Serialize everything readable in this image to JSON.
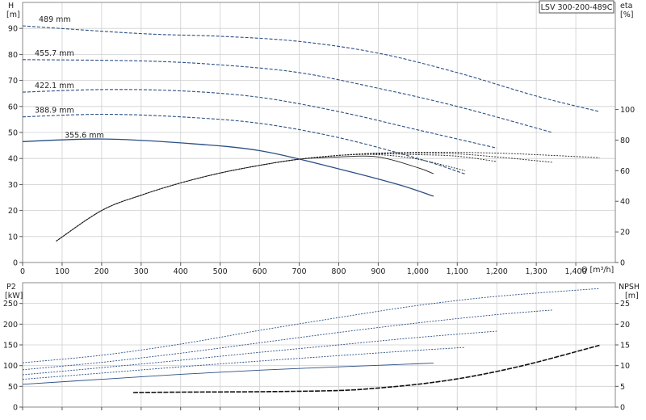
{
  "model_label": "LSV 300-200-489C",
  "colors": {
    "curve": "#2a4f85",
    "eff": "#222222",
    "npsh": "#111111",
    "grid": "#cfcfcf",
    "frame": "#8a8a8a"
  },
  "chart_data": [
    {
      "type": "line",
      "name": "head-efficiency",
      "ylabel": [
        "H",
        "[m]"
      ],
      "y2label": [
        "eta",
        "[%]"
      ],
      "xlabel": "Q [m³/h]",
      "xlim": [
        0,
        1500
      ],
      "ylim": [
        0,
        100
      ],
      "y2lim": [
        0,
        170
      ],
      "xticks": [
        0,
        100,
        200,
        300,
        400,
        500,
        600,
        700,
        800,
        900,
        1000,
        1100,
        1200,
        1300,
        1400
      ],
      "xtick_labels": [
        "0",
        "100",
        "200",
        "300",
        "400",
        "500",
        "600",
        "700",
        "800",
        "900",
        "1,000",
        "1,100",
        "1,200",
        "1,300",
        "1,400"
      ],
      "yticks": [
        0,
        10,
        20,
        30,
        40,
        50,
        60,
        70,
        80,
        90
      ],
      "y2ticks": [
        0,
        20,
        40,
        60,
        80,
        100
      ],
      "grid": true,
      "head_series": [
        {
          "name": "489 mm",
          "x": [
            0,
            300,
            500,
            700,
            900,
            1100,
            1300,
            1460
          ],
          "y": [
            91,
            88,
            87,
            85,
            80.5,
            73,
            64,
            58
          ]
        },
        {
          "name": "455.7 mm",
          "x": [
            0,
            300,
            500,
            700,
            900,
            1100,
            1340
          ],
          "y": [
            78,
            77.5,
            76,
            73,
            67,
            60,
            50
          ]
        },
        {
          "name": "422.1 mm",
          "x": [
            0,
            200,
            400,
            600,
            800,
            1000,
            1200
          ],
          "y": [
            65.5,
            66.5,
            66,
            63.5,
            58,
            51,
            44
          ]
        },
        {
          "name": "388.9 mm",
          "x": [
            0,
            200,
            400,
            600,
            800,
            1000,
            1120
          ],
          "y": [
            56,
            57,
            56,
            53.5,
            48,
            40,
            34
          ]
        },
        {
          "name": "355.6 mm",
          "x": [
            0,
            200,
            400,
            600,
            800,
            950,
            1040
          ],
          "y": [
            46.5,
            47.5,
            46,
            43,
            36,
            30,
            25.5
          ]
        }
      ],
      "efficiency_series": [
        {
          "x": [
            85,
            200,
            300,
            400,
            500,
            600,
            700,
            800,
            900,
            1000,
            1040
          ],
          "y": [
            14,
            34,
            44,
            52,
            58.5,
            63.5,
            67.5,
            69,
            69,
            62,
            58
          ]
        },
        {
          "x": [
            85,
            200,
            300,
            400,
            500,
            600,
            700,
            800,
            900,
            1000,
            1120
          ],
          "y": [
            14,
            34,
            44,
            52,
            58.5,
            63.5,
            67.5,
            70,
            70.5,
            67.5,
            60
          ]
        },
        {
          "x": [
            85,
            200,
            300,
            400,
            500,
            600,
            700,
            800,
            900,
            1000,
            1100,
            1200
          ],
          "y": [
            14,
            34,
            44,
            52,
            58.5,
            63.5,
            67.5,
            70,
            71,
            70.5,
            69.5,
            66
          ]
        },
        {
          "x": [
            85,
            200,
            300,
            400,
            500,
            600,
            700,
            800,
            900,
            1000,
            1100,
            1200,
            1340
          ],
          "y": [
            14,
            34,
            44,
            52,
            58.5,
            63.5,
            67.5,
            70,
            71.5,
            71.5,
            71,
            69,
            65.5
          ]
        },
        {
          "x": [
            85,
            200,
            300,
            400,
            500,
            600,
            700,
            800,
            900,
            1000,
            1100,
            1200,
            1300,
            1460
          ],
          "y": [
            14,
            34,
            44,
            52,
            58.5,
            63.5,
            67.5,
            70,
            71.5,
            72,
            72,
            71.5,
            70.5,
            68.5
          ]
        }
      ]
    },
    {
      "type": "line",
      "name": "power-npsh",
      "ylabel": [
        "P2",
        "[kW]"
      ],
      "y2label": [
        "NPSH",
        "[m]"
      ],
      "xlim": [
        0,
        1500
      ],
      "ylim": [
        0,
        300
      ],
      "y2lim": [
        0,
        30
      ],
      "yticks": [
        0,
        50,
        100,
        150,
        200,
        250
      ],
      "y2ticks": [
        0,
        5,
        10,
        15,
        20,
        25
      ],
      "grid": true,
      "power_series": [
        {
          "name": "489 mm",
          "x": [
            0,
            200,
            400,
            600,
            800,
            1000,
            1200,
            1460
          ],
          "y": [
            107,
            125,
            152,
            185,
            216,
            245,
            267,
            286
          ]
        },
        {
          "name": "455.7 mm",
          "x": [
            0,
            200,
            400,
            600,
            800,
            1000,
            1200,
            1340
          ],
          "y": [
            90,
            108,
            130,
            155,
            180,
            203,
            223,
            234
          ]
        },
        {
          "name": "422.1 mm",
          "x": [
            0,
            200,
            400,
            600,
            800,
            1000,
            1200
          ],
          "y": [
            78,
            95,
            113,
            132,
            150,
            168,
            183
          ]
        },
        {
          "name": "388.9 mm",
          "x": [
            0,
            200,
            400,
            600,
            800,
            1000,
            1120
          ],
          "y": [
            67,
            82,
            97,
            111,
            124,
            137,
            144
          ]
        },
        {
          "name": "355.6 mm",
          "x": [
            0,
            200,
            400,
            600,
            800,
            1040
          ],
          "y": [
            55,
            67,
            79,
            89,
            97,
            106
          ]
        }
      ],
      "npsh_series": [
        {
          "x": [
            280,
            400,
            600,
            800,
            900,
            1000,
            1100,
            1200,
            1300,
            1460
          ],
          "y": [
            3.5,
            3.6,
            3.7,
            4.0,
            4.6,
            5.5,
            6.8,
            8.6,
            10.8,
            14.9
          ]
        }
      ]
    }
  ]
}
